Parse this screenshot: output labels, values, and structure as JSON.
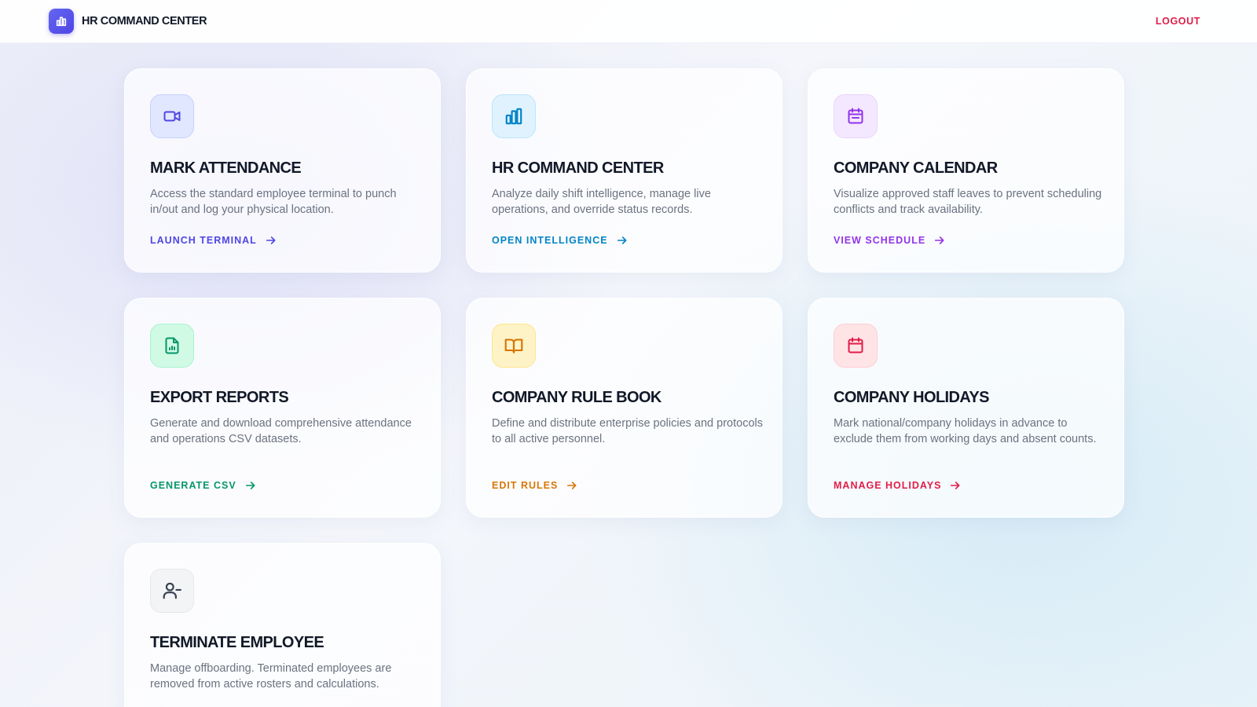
{
  "header": {
    "brand_title": "HR COMMAND CENTER",
    "logout_label": "LOGOUT"
  },
  "cards": [
    {
      "title": "MARK ATTENDANCE",
      "description": "Access the standard employee terminal to punch in/out and log your physical location.",
      "action": "LAUNCH TERMINAL",
      "icon": "video-icon",
      "accent": "#4f46e5"
    },
    {
      "title": "HR COMMAND CENTER",
      "description": "Analyze daily shift intelligence, manage live operations, and override status records.",
      "action": "OPEN INTELLIGENCE",
      "icon": "bar-chart-icon",
      "accent": "#0284c7"
    },
    {
      "title": "COMPANY CALENDAR",
      "description": "Visualize approved staff leaves to prevent scheduling conflicts and track availability.",
      "action": "VIEW SCHEDULE",
      "icon": "calendar-icon",
      "accent": "#9333ea"
    },
    {
      "title": "EXPORT REPORTS",
      "description": "Generate and download comprehensive attendance and operations CSV datasets.",
      "action": "GENERATE CSV",
      "icon": "file-chart-icon",
      "accent": "#059669"
    },
    {
      "title": "COMPANY RULE BOOK",
      "description": "Define and distribute enterprise policies and protocols to all active personnel.",
      "action": "EDIT RULES",
      "icon": "book-open-icon",
      "accent": "#d97706"
    },
    {
      "title": "COMPANY HOLIDAYS",
      "description": "Mark national/company holidays in advance to exclude them from working days and absent counts.",
      "action": "MANAGE HOLIDAYS",
      "icon": "calendar-icon",
      "accent": "#e11d48"
    },
    {
      "title": "TERMINATE EMPLOYEE",
      "description": "Manage offboarding. Terminated employees are removed from active rosters and calculations.",
      "action": "",
      "icon": "user-minus-icon",
      "accent": "#374151"
    }
  ]
}
